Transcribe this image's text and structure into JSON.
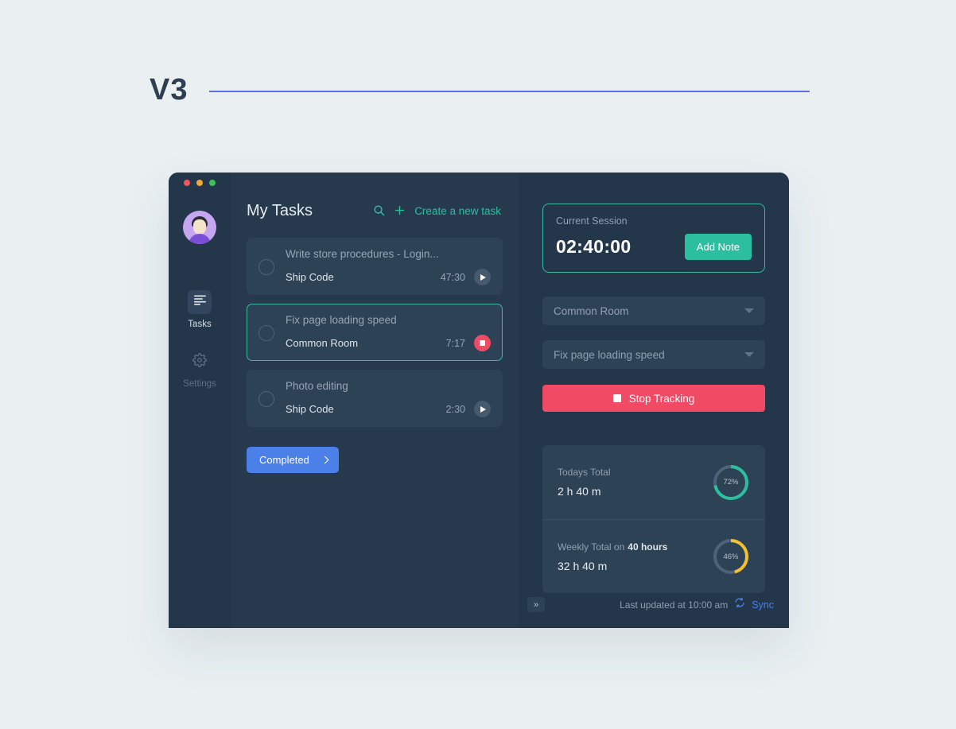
{
  "version": {
    "label": "V3"
  },
  "window": {
    "controls": [
      "close",
      "minimize",
      "maximize"
    ]
  },
  "sidebar": {
    "avatar_name": "user-avatar",
    "items": [
      {
        "label": "Tasks",
        "icon": "list-icon",
        "active": true
      },
      {
        "label": "Settings",
        "icon": "gear-icon",
        "active": false
      }
    ]
  },
  "main": {
    "title": "My Tasks",
    "search_icon": "search-icon",
    "add_icon": "plus-icon",
    "create_label": "Create a new task",
    "tasks": [
      {
        "title": "Write store procedures - Login...",
        "project": "Ship Code",
        "time": "47:30",
        "control": "play",
        "active": false
      },
      {
        "title": "Fix page loading speed",
        "project": "Common Room",
        "time": "7:17",
        "control": "stop",
        "active": true
      },
      {
        "title": "Photo editing",
        "project": "Ship Code",
        "time": "2:30",
        "control": "play",
        "active": false
      }
    ],
    "completed_label": "Completed"
  },
  "session": {
    "label": "Current Session",
    "time": "02:40:00",
    "add_note_label": "Add Note"
  },
  "selectors": {
    "project": "Common Room",
    "task": "Fix page loading speed"
  },
  "tracking": {
    "stop_label": "Stop Tracking"
  },
  "totals": {
    "today": {
      "label": "Todays Total",
      "value": "2 h 40 m",
      "percent_label": "72%",
      "percent": 72,
      "color": "#2bbfa0"
    },
    "weekly": {
      "label": "Weekly Total on",
      "label_strong": "40 hours",
      "value": "32 h 40 m",
      "percent_label": "46%",
      "percent": 46,
      "color": "#f5c02e"
    }
  },
  "footer": {
    "collapse_icon": "»",
    "last_updated": "Last updated at 10:00 am",
    "sync_label": "Sync",
    "sync_icon": "refresh-icon"
  },
  "colors": {
    "accent_teal": "#2bbfa0",
    "accent_red": "#f04a65",
    "accent_blue": "#4a80e8",
    "accent_yellow": "#f5c02e",
    "rule_purple": "#5b6fe0"
  }
}
